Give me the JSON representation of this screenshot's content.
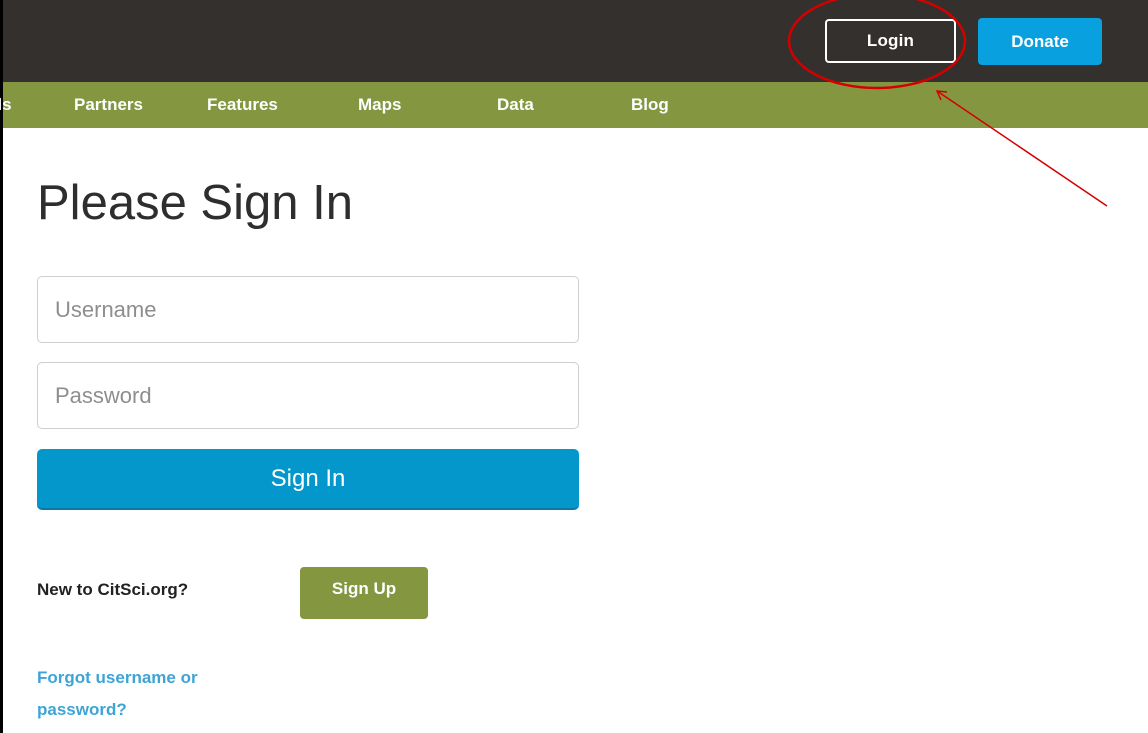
{
  "header": {
    "login_label": "Login",
    "donate_label": "Donate"
  },
  "nav": {
    "items": [
      {
        "label": "ols"
      },
      {
        "label": "Partners"
      },
      {
        "label": "Features"
      },
      {
        "label": "Maps"
      },
      {
        "label": "Data"
      },
      {
        "label": "Blog"
      }
    ]
  },
  "signin": {
    "title": "Please Sign In",
    "username_placeholder": "Username",
    "password_placeholder": "Password",
    "button_label": "Sign In"
  },
  "signup": {
    "prompt": "New to CitSci.org?",
    "button_label": "Sign Up"
  },
  "forgot": {
    "label": "Forgot username or password?"
  },
  "colors": {
    "topbar": "#33302d",
    "nav": "#849740",
    "accent_blue": "#08a0df",
    "annotation_red": "#d40000"
  }
}
